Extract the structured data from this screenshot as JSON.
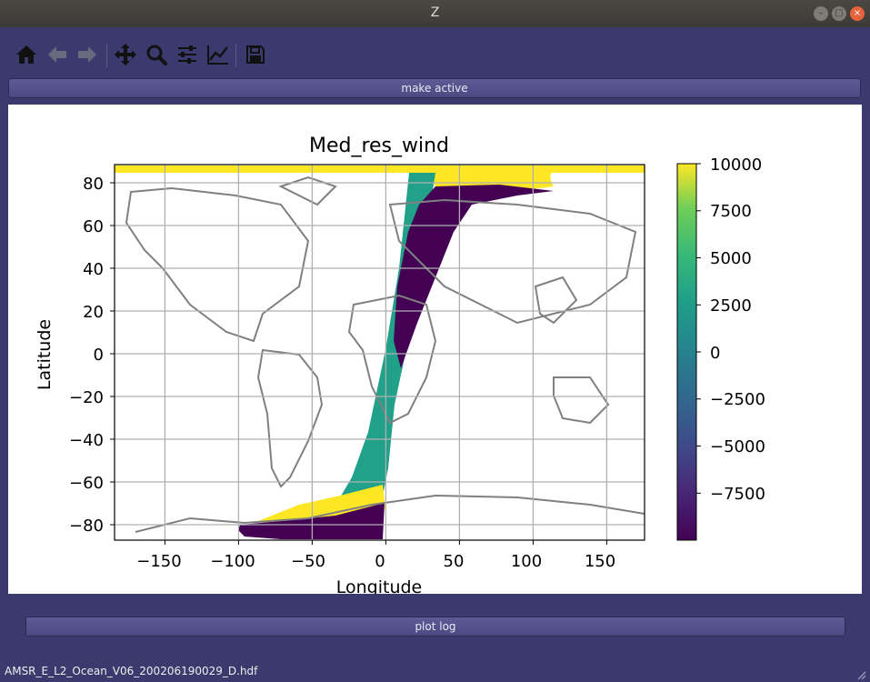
{
  "window": {
    "title": "Z"
  },
  "toolbar": {
    "icons": [
      "home-icon",
      "back-arrow-icon",
      "forward-arrow-icon",
      "pan-move-icon",
      "zoom-magnifier-icon",
      "configure-subplots-icon",
      "edit-axis-curve-icon",
      "save-floppy-icon"
    ]
  },
  "buttons": {
    "make_active": "make active",
    "plot_log": "plot log"
  },
  "status_bar": {
    "filename": "AMSR_E_L2_Ocean_V06_200206190029_D.hdf"
  },
  "chart_data": {
    "type": "heatmap",
    "title": "Med_res_wind",
    "xlabel": "Longitude",
    "ylabel": "Latitude",
    "xlim": [
      -180,
      180
    ],
    "ylim": [
      -87,
      90
    ],
    "xticks": [
      -150,
      -100,
      -50,
      0,
      50,
      100,
      150
    ],
    "xtick_labels": [
      "−150",
      "−100",
      "−50",
      "0",
      "50",
      "100",
      "150"
    ],
    "yticks": [
      -80,
      -60,
      -40,
      -20,
      0,
      20,
      40,
      60,
      80
    ],
    "ytick_labels": [
      "−80",
      "−60",
      "−40",
      "−20",
      "0",
      "20",
      "40",
      "60",
      "80"
    ],
    "grid": true,
    "colormap": "viridis",
    "colorbar": {
      "vmin": -10000,
      "vmax": 10000,
      "ticks": [
        10000,
        7500,
        5000,
        2500,
        0,
        -2500,
        -5000,
        -7500
      ],
      "tick_labels": [
        "10000",
        "7500",
        "5000",
        "2500",
        "0",
        "−2500",
        "−5000",
        "−7500"
      ]
    },
    "colors": {
      "high": "#fde725",
      "mid": "#21a08a",
      "low": "#440154",
      "coast": "#808080"
    }
  }
}
